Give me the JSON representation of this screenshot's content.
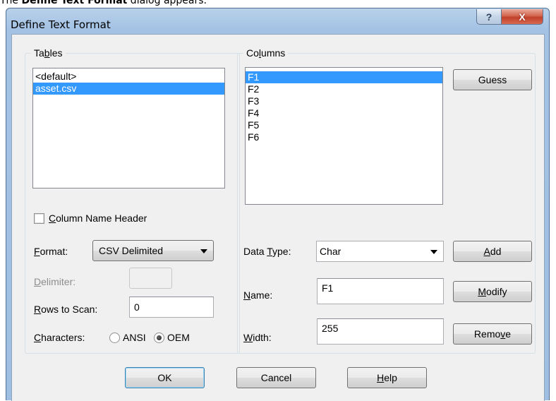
{
  "caption": {
    "prefix": "The ",
    "bold": "Define Text Format",
    "suffix": " dialog appears."
  },
  "dialog": {
    "title": "Define Text Format",
    "help_glyph": "?",
    "close_glyph": "X"
  },
  "tables": {
    "group_label_pre": "Ta",
    "group_label_u": "b",
    "group_label_post": "les",
    "items": [
      "<default>",
      "asset.csv"
    ],
    "selected_index": 1
  },
  "columns": {
    "group_label_pre": "Co",
    "group_label_u": "l",
    "group_label_post": "umns",
    "items": [
      "F1",
      "F2",
      "F3",
      "F4",
      "F5",
      "F6"
    ],
    "selected_index": 0
  },
  "buttons": {
    "guess": "Guess",
    "add_u": "A",
    "add_post": "dd",
    "modify_u": "M",
    "modify_post": "odify",
    "remove_pre": "Remo",
    "remove_u": "v",
    "remove_post": "e",
    "ok": "OK",
    "cancel": "Cancel",
    "help_u": "H",
    "help_post": "elp"
  },
  "column_name_header": {
    "label_pre": "",
    "label_u": "C",
    "label_post": "olumn Name Header",
    "checked": false
  },
  "format": {
    "label_u": "F",
    "label_post": "ormat:",
    "value": "CSV Delimited"
  },
  "delimiter": {
    "label_u": "D",
    "label_post": "elimiter:",
    "value": ""
  },
  "rows_to_scan": {
    "label_u": "R",
    "label_post": "ows to Scan:",
    "value": "0"
  },
  "characters": {
    "label_u": "C",
    "label_post": "haracters:",
    "options": [
      "ANSI",
      "OEM"
    ],
    "selected": "OEM"
  },
  "data_type": {
    "label_pre": "Data ",
    "label_u": "T",
    "label_post": "ype:",
    "value": "Char"
  },
  "name_field": {
    "label_u": "N",
    "label_post": "ame:",
    "value": "F1"
  },
  "width_field": {
    "label_u": "W",
    "label_post": "idth:",
    "value": "255"
  }
}
